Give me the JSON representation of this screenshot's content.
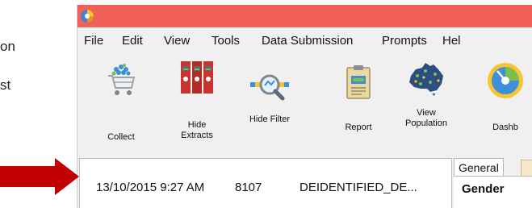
{
  "background_text": {
    "line1": "on",
    "line2": "st"
  },
  "app": {
    "titlebar_color": "#f2605a",
    "logo_icon": "app-logo-icon"
  },
  "menu": [
    "File",
    "Edit",
    "View",
    "Tools",
    "Data Submission",
    "Prompts",
    "Hel"
  ],
  "toolbar": [
    {
      "label": "Collect",
      "icon": "shopping-cart-icon"
    },
    {
      "label": "Hide\nExtracts",
      "icon": "binders-icon"
    },
    {
      "label": "Hide Filter",
      "icon": "magnifier-filter-icon"
    },
    {
      "label": "Report",
      "icon": "clipboard-report-icon"
    },
    {
      "label": "View\nPopulation",
      "icon": "australia-map-icon"
    },
    {
      "label": "Dashb",
      "icon": "dashboard-gauge-icon"
    }
  ],
  "record": {
    "datetime": "13/10/2015 9:27 AM",
    "id": "8107",
    "name": "DEIDENTIFIED_DE..."
  },
  "detail": {
    "tab_general": "General",
    "field_label": "Gender"
  },
  "annotation": {
    "arrow_color": "#c00000"
  }
}
